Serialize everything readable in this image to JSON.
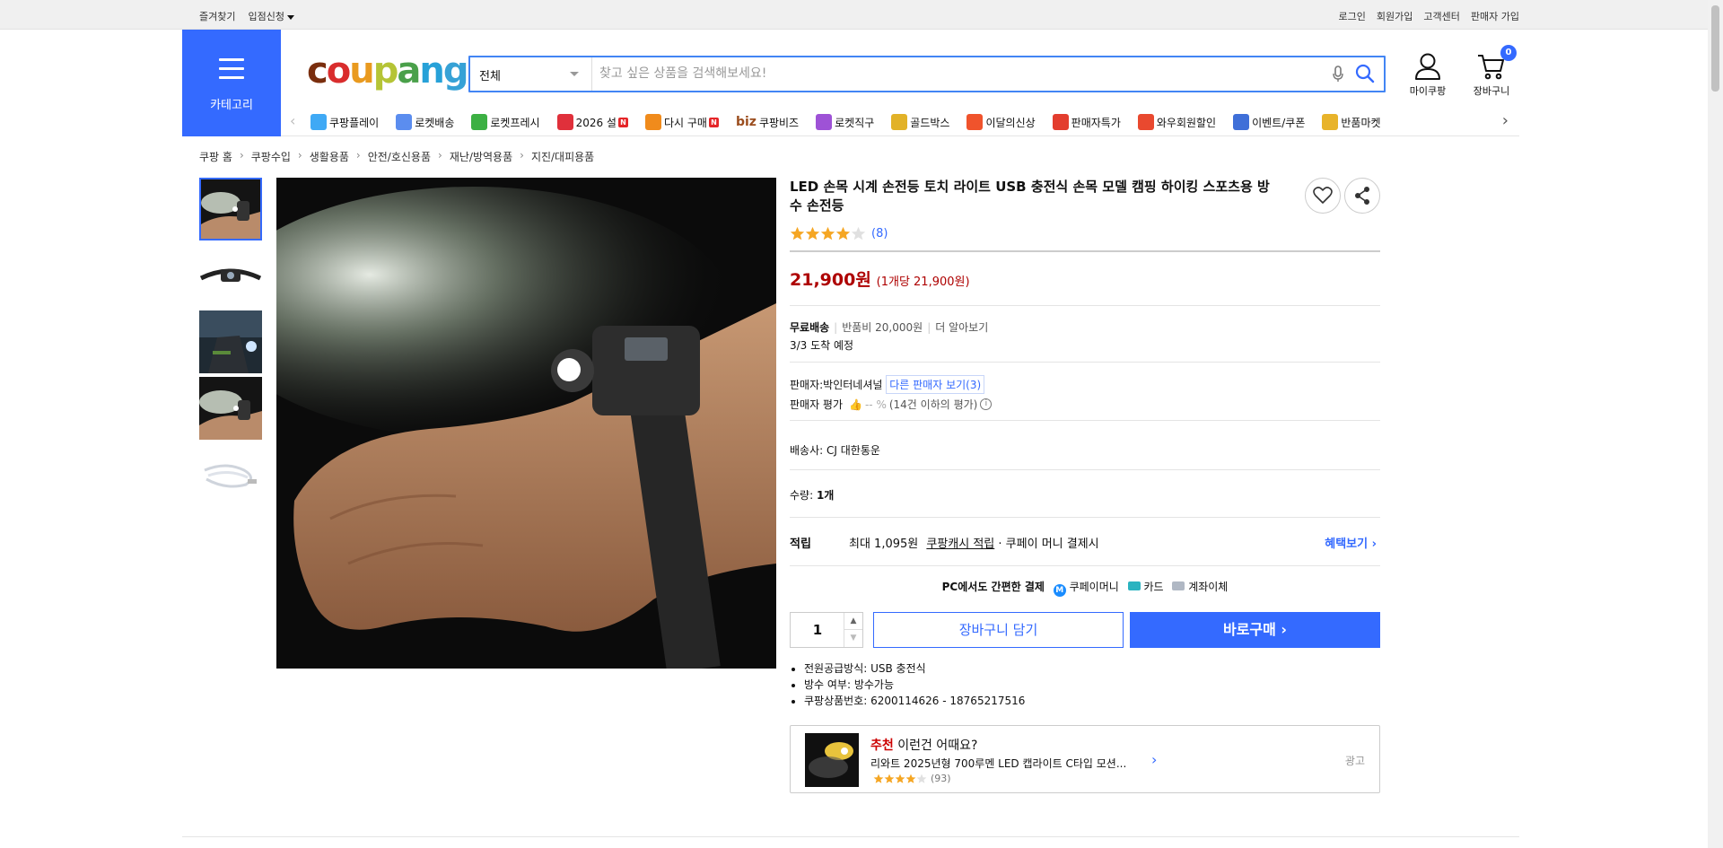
{
  "topbar": {
    "left": [
      "즐겨찾기",
      "입점신청"
    ],
    "right": [
      "로그인",
      "회원가입",
      "고객센터",
      "판매자 가입"
    ]
  },
  "header": {
    "category_label": "카테고리",
    "logo": [
      "c",
      "o",
      "u",
      "p",
      "a",
      "n",
      "g"
    ],
    "logo_colors": [
      "#7a2e0e",
      "#d92d2d",
      "#e99a1f",
      "#b5c436",
      "#4aa04a",
      "#27a1d8",
      "#37a2d6"
    ],
    "search": {
      "scope": "전체",
      "placeholder": "찾고 싶은 상품을 검색해보세요!"
    },
    "mycoupang_label": "마이쿠팡",
    "cart_label": "장바구니",
    "cart_count": "0"
  },
  "quick_menu": [
    {
      "label": "쿠팡플레이",
      "icon": "play-icon",
      "color": "#3fa9f5",
      "new": false
    },
    {
      "label": "로켓배송",
      "icon": "rocket-icon",
      "color": "#5b8def",
      "new": false
    },
    {
      "label": "로켓프레시",
      "icon": "rocket-fresh-icon",
      "color": "#3cb043",
      "new": false
    },
    {
      "label": "2026 설",
      "icon": "gift-icon",
      "color": "#e0303b",
      "new": true
    },
    {
      "label": "다시 구매",
      "icon": "house-icon",
      "color": "#f08b1c",
      "new": true
    },
    {
      "label": "쿠팡비즈",
      "icon": "biz-icon",
      "color": "#9b4d1e",
      "new": false
    },
    {
      "label": "로켓직구",
      "icon": "rocket-global-icon",
      "color": "#9e52d6",
      "new": false
    },
    {
      "label": "골드박스",
      "icon": "goldbox-icon",
      "color": "#e2b228",
      "new": false
    },
    {
      "label": "이달의신상",
      "icon": "bag-icon",
      "color": "#f0532c",
      "new": false
    },
    {
      "label": "판매자특가",
      "icon": "discount-icon",
      "color": "#e33d2e",
      "new": false
    },
    {
      "label": "와우회원할인",
      "icon": "wow-icon",
      "color": "#e9492f",
      "new": false
    },
    {
      "label": "이벤트/쿠폰",
      "icon": "coupon-icon",
      "color": "#3f6fd8",
      "new": false
    },
    {
      "label": "반품마켓",
      "icon": "market-icon",
      "color": "#e8b32a",
      "new": false
    }
  ],
  "biz_prefix": "biz",
  "breadcrumb": [
    "쿠팡 홈",
    "쿠팡수입",
    "생활용품",
    "안전/호신용품",
    "재난/방역용품",
    "지진/대피용품"
  ],
  "product": {
    "title": "LED 손목 시계 손전등 토치 라이트 USB 충전식 손목 모델 캠핑 하이킹 스포츠용 방수 손전등",
    "rating": 4,
    "review_count": "(8)",
    "price": "21,900원",
    "unit_price": "(1개당 21,900원)",
    "shipping": {
      "type": "무료배송",
      "return_fee": "반품비 20,000원",
      "more": "더 알아보기",
      "arrival": "3/3 도착 예정"
    },
    "seller": {
      "label": "판매자:",
      "name": "박인터네셔널",
      "other_sellers": "다른 판매자 보기(3)",
      "rating_label": "판매자 평가",
      "rating_value": "-- %",
      "rating_note": "(14건 이하의 평가)"
    },
    "carrier": {
      "label": "배송사:",
      "name": "CJ 대한통운"
    },
    "quantity": {
      "label": "수량:",
      "value": "1개"
    },
    "reward": {
      "label": "적립",
      "text_before": "최대 1,095원",
      "link": "쿠팡캐시 적립",
      "text_after": "· 쿠페이 머니 결제시",
      "benefit": "혜택보기"
    },
    "pay_methods": {
      "label": "PC에서도 간편한 결제",
      "items": [
        "쿠페이머니",
        "카드",
        "계좌이체"
      ]
    },
    "qty_input": "1",
    "add_to_cart": "장바구니 담기",
    "buy_now": "바로구매",
    "bullets": [
      "전원공급방식: USB 충전식",
      "방수 여부: 방수가능",
      "쿠팡상품번호: 6200114626 - 18765217516"
    ]
  },
  "recommend": {
    "highlight": "추천",
    "heading": "이런건 어때요?",
    "name": "리와트 2025년형 700루멘 LED 캡라이트 C타입 모션...",
    "rating": 4,
    "count": "(93)",
    "ad": "광고"
  },
  "colors": {
    "accent": "#346aff",
    "price": "#ae0000",
    "star": "#f5a623"
  }
}
